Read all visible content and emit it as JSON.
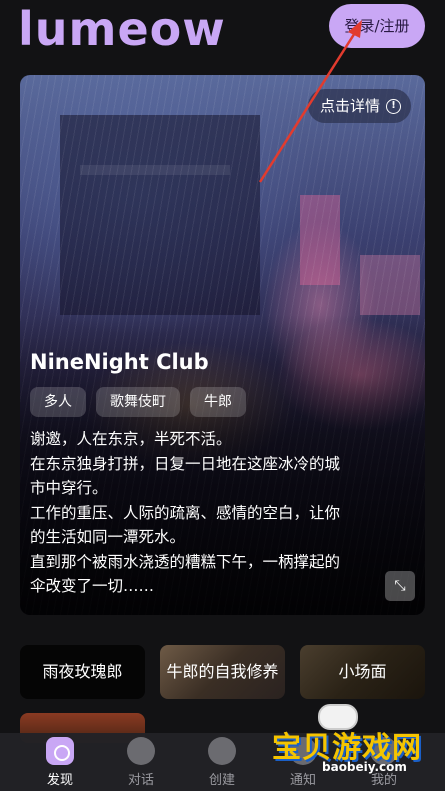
{
  "header": {
    "logo": "lumeow",
    "login_label": "登录/注册"
  },
  "hero": {
    "detail_label": "点击详情",
    "title": "NineNight Club",
    "tags": [
      "多人",
      "歌舞伎町",
      "牛郎"
    ],
    "description_lines": [
      "谢邀，人在东京，半死不活。",
      "在东京独身打拼，日复一日地在这座冰冷的城",
      "市中穿行。",
      "工作的重压、人际的疏离、感情的空白，让你",
      "的生活如同一潭死水。",
      "直到那个被雨水浇透的糟糕下午，一柄撑起的",
      "伞改变了一切……"
    ]
  },
  "categories": [
    "雨夜玫瑰郎",
    "牛郎的自我修养",
    "小场面",
    ""
  ],
  "tabbar": {
    "items": [
      {
        "label": "发现",
        "icon": "discover-icon",
        "active": true
      },
      {
        "label": "对话",
        "icon": "chat-icon",
        "active": false
      },
      {
        "label": "创建",
        "icon": "create-icon",
        "active": false
      },
      {
        "label": "通知",
        "icon": "notification-icon",
        "active": false
      },
      {
        "label": "我的",
        "icon": "profile-icon",
        "active": false
      }
    ]
  },
  "watermark": {
    "text": "宝贝游戏网",
    "url": "baobeiy.com"
  },
  "colors": {
    "accent": "#c9a7f5",
    "annotation_arrow": "#e23b2e"
  }
}
